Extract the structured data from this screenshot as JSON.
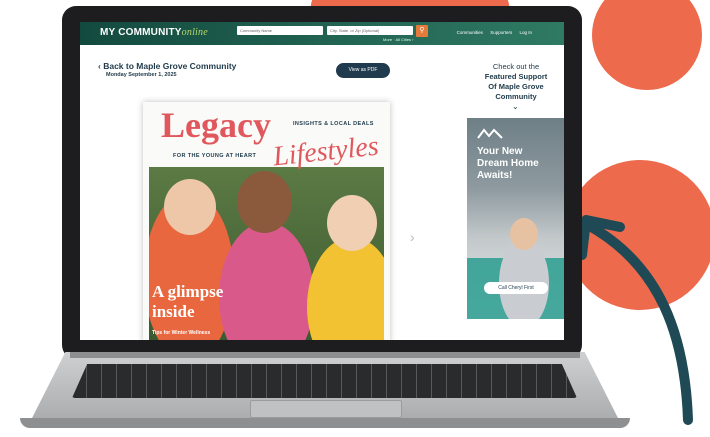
{
  "site": {
    "logo_main": "MY COMMUNITY",
    "logo_accent": "online",
    "search_community_placeholder": "Community Name",
    "search_city_placeholder": "City, State, or Zip (Optional)",
    "more_link": "More · All Cities ›",
    "nav_links": [
      "Communities",
      "Supporters",
      "Log In"
    ]
  },
  "page": {
    "back_link": "Back to Maple Grove Community",
    "date": "Monday September 1, 2025",
    "pdf_button": "View as PDF",
    "featured_line1": "Check out the",
    "featured_line2": "Featured Support",
    "featured_line3": "Of Maple Grove",
    "featured_line4": "Community"
  },
  "magazine": {
    "title_main": "Legacy",
    "insights": "INSIGHTS & LOCAL DEALS",
    "tagline": "FOR THE YOUNG AT HEART",
    "title_script": "Lifestyles",
    "cover_line1": "A glimpse",
    "cover_line2": "inside",
    "cover_sub": "Tips for Winter Wellness"
  },
  "ad": {
    "headline_line1": "Your New",
    "headline_line2": "Dream Home",
    "headline_line3": "Awaits!",
    "button": "Call Cheryl First"
  },
  "colors": {
    "accent_coral": "#ee6a4d",
    "arrow_teal": "#1f4a55",
    "nav_green": "#1c5a4a",
    "brand_pink": "#e0585d"
  },
  "icons": [
    "chevron-left-icon",
    "search-icon",
    "chevron-down-icon",
    "chevron-right-icon",
    "ad-logo-icon"
  ]
}
